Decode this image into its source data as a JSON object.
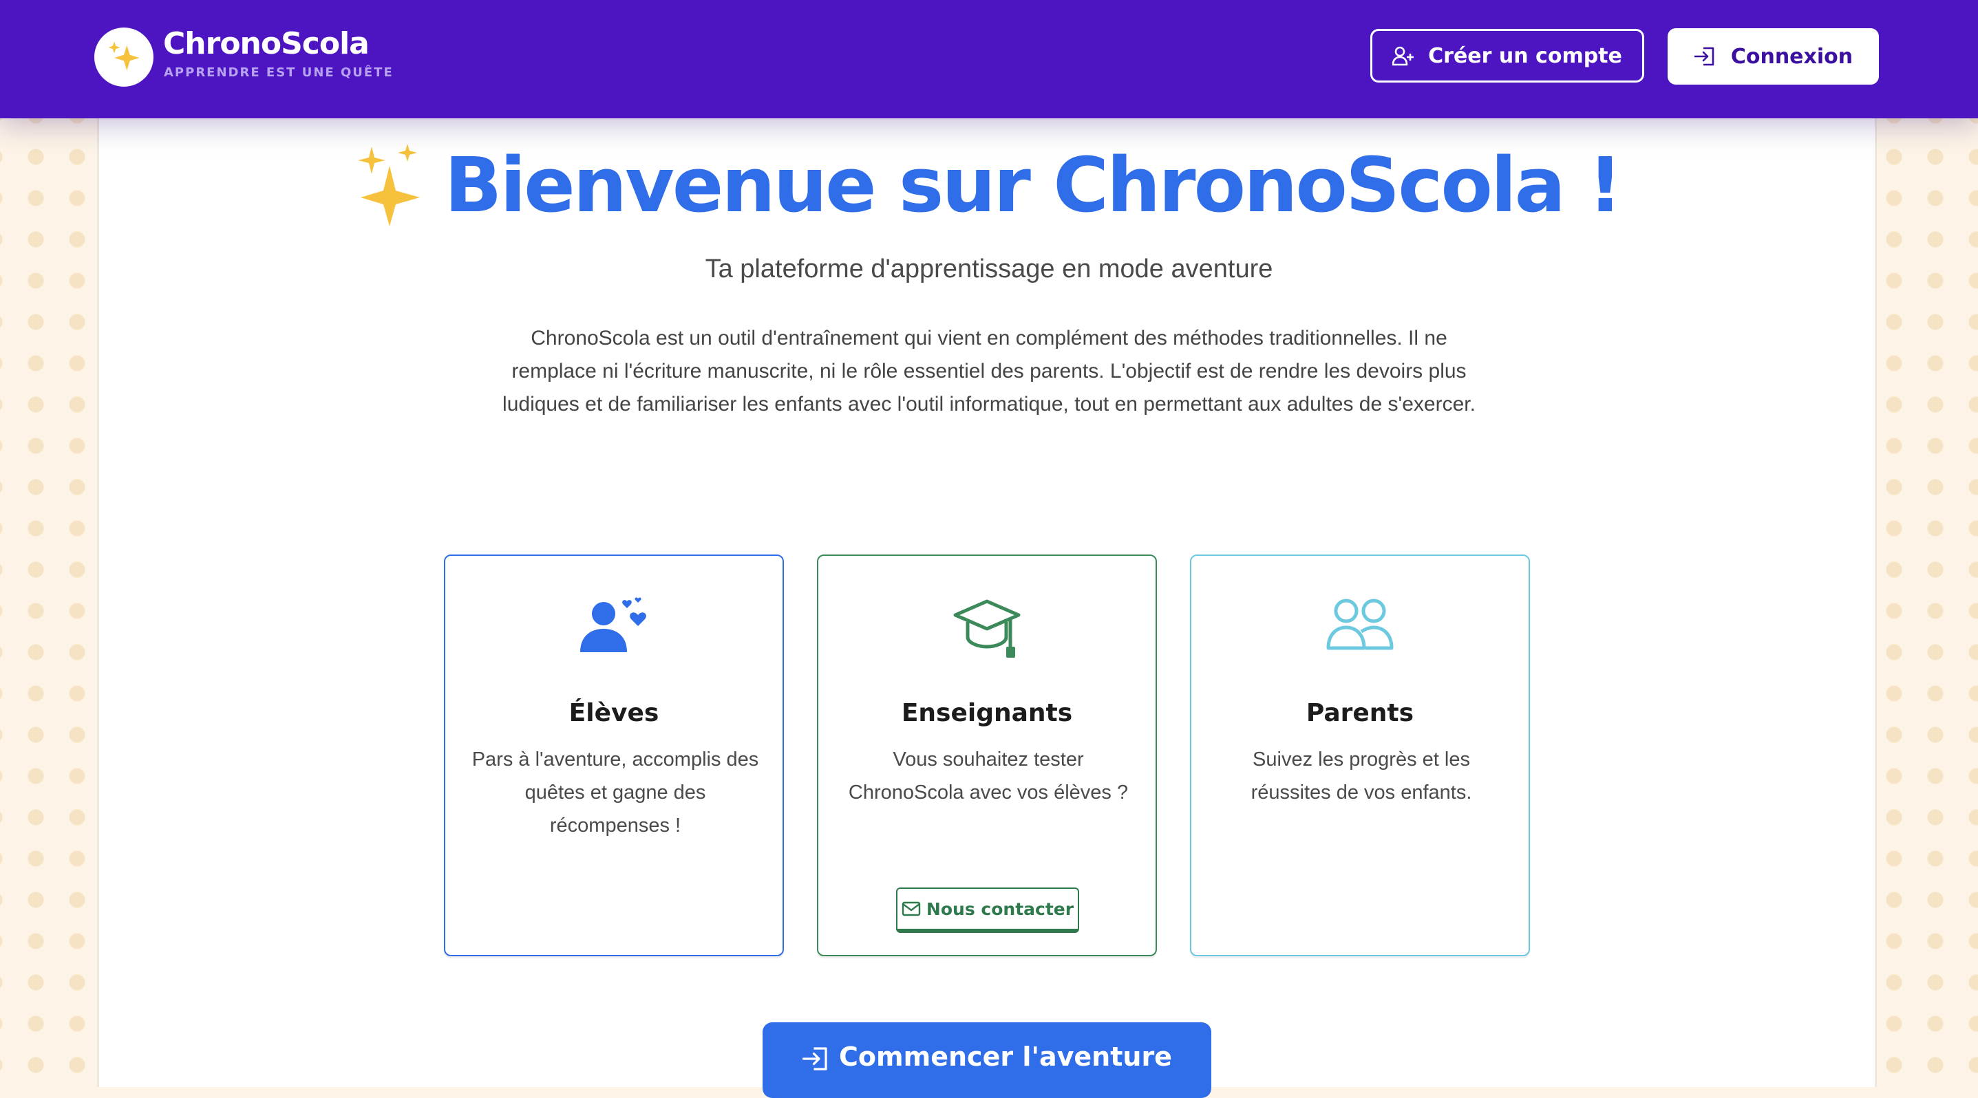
{
  "header": {
    "brand_name": "ChronoScola",
    "brand_tagline": "APPRENDRE EST UNE QUÊTE",
    "logo_icon": "sparkles-icon",
    "signup_label": "Créer un compte",
    "signup_icon": "user-plus-icon",
    "login_label": "Connexion",
    "login_icon": "sign-in-icon"
  },
  "hero": {
    "title": "Bienvenue sur ChronoScola !",
    "title_icon": "sparkles-icon",
    "subtitle": "Ta plateforme d'apprentissage en mode aventure",
    "intro": "ChronoScola est un outil d'entraînement qui vient en complément des méthodes traditionnelles. Il ne remplace ni l'écriture manuscrite, ni le rôle essentiel des parents. L'objectif est de rendre les devoirs plus ludiques et de familiariser les enfants avec l'outil informatique, tout en permettant aux adultes de s'exercer."
  },
  "cards": [
    {
      "title": "Élèves",
      "description": "Pars à l'aventure, accomplis des quêtes et gagne des récompenses !",
      "icon": "student-hearts-icon",
      "accent": "#2f6ee8"
    },
    {
      "title": "Enseignants",
      "description": "Vous souhaitez tester ChronoScola avec vos élèves ?",
      "icon": "graduation-cap-icon",
      "accent": "#3c8a5a",
      "button_label": "Nous contacter",
      "button_icon": "envelope-icon"
    },
    {
      "title": "Parents",
      "description": "Suivez les progrès et les réussites de vos enfants.",
      "icon": "people-icon",
      "accent": "#6cc9e0"
    }
  ],
  "cta": {
    "label": "Commencer l'aventure",
    "icon": "sign-in-icon"
  },
  "colors": {
    "header_bg": "#4c15c1",
    "primary_blue": "#2f6ee8",
    "teacher_green": "#3c8a5a",
    "parent_cyan": "#6cc9e0",
    "sparkle_gold": "#f6c23e",
    "page_bg": "#fdf4e7"
  }
}
